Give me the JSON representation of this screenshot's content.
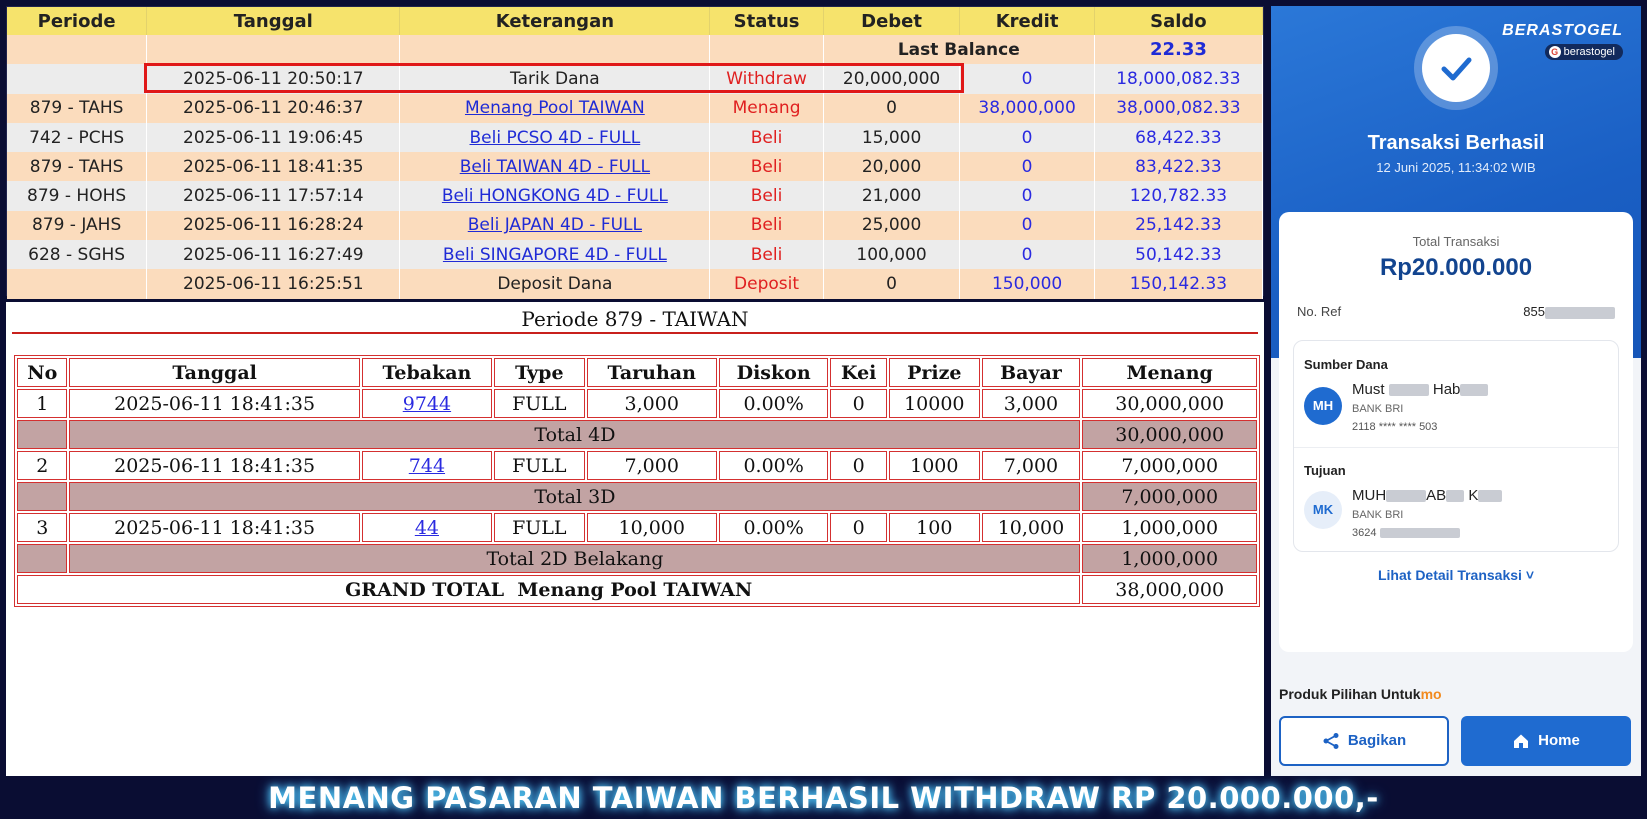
{
  "ledger": {
    "headers": [
      "Periode",
      "Tanggal",
      "Keterangan",
      "Status",
      "Debet",
      "Kredit",
      "Saldo"
    ],
    "last_balance_label": "Last Balance",
    "last_balance_value": "22.33",
    "rows": [
      {
        "periode": "",
        "tanggal": "2025-06-11 20:50:17",
        "ket": "Tarik Dana",
        "status": "Withdraw",
        "debet": "20,000,000",
        "kredit": "0",
        "saldo": "18,000,082.33"
      },
      {
        "periode": "879 - TAHS",
        "tanggal": "2025-06-11 20:46:37",
        "ket": "Menang Pool TAIWAN",
        "status": "Menang",
        "debet": "0",
        "kredit": "38,000,000",
        "saldo": "38,000,082.33"
      },
      {
        "periode": "742 - PCHS",
        "tanggal": "2025-06-11 19:06:45",
        "ket": "Beli PCSO 4D - FULL",
        "status": "Beli",
        "debet": "15,000",
        "kredit": "0",
        "saldo": "68,422.33"
      },
      {
        "periode": "879 - TAHS",
        "tanggal": "2025-06-11 18:41:35",
        "ket": "Beli TAIWAN 4D - FULL",
        "status": "Beli",
        "debet": "20,000",
        "kredit": "0",
        "saldo": "83,422.33"
      },
      {
        "periode": "879 - HOHS",
        "tanggal": "2025-06-11 17:57:14",
        "ket": "Beli HONGKONG 4D - FULL",
        "status": "Beli",
        "debet": "21,000",
        "kredit": "0",
        "saldo": "120,782.33"
      },
      {
        "periode": "879 - JAHS",
        "tanggal": "2025-06-11 16:28:24",
        "ket": "Beli JAPAN 4D - FULL",
        "status": "Beli",
        "debet": "25,000",
        "kredit": "0",
        "saldo": "25,142.33"
      },
      {
        "periode": "628 - SGHS",
        "tanggal": "2025-06-11 16:27:49",
        "ket": "Beli SINGAPORE 4D - FULL",
        "status": "Beli",
        "debet": "100,000",
        "kredit": "0",
        "saldo": "50,142.33"
      },
      {
        "periode": "",
        "tanggal": "2025-06-11 16:25:51",
        "ket": "Deposit Dana",
        "status": "Deposit",
        "debet": "0",
        "kredit": "150,000",
        "saldo": "150,142.33"
      }
    ]
  },
  "detail": {
    "title": "Periode 879 - TAIWAN",
    "headers": [
      "No",
      "Tanggal",
      "Tebakan",
      "Type",
      "Taruhan",
      "Diskon",
      "Kei",
      "Prize",
      "Bayar",
      "Menang"
    ],
    "bets": [
      {
        "no": "1",
        "tanggal": "2025-06-11 18:41:35",
        "tebakan": "9744",
        "type": "FULL",
        "taruhan": "3,000",
        "diskon": "0.00%",
        "kei": "0",
        "prize": "10000",
        "bayar": "3,000",
        "menang": "30,000,000",
        "total_label": "Total 4D",
        "total_value": "30,000,000"
      },
      {
        "no": "2",
        "tanggal": "2025-06-11 18:41:35",
        "tebakan": "744",
        "type": "FULL",
        "taruhan": "7,000",
        "diskon": "0.00%",
        "kei": "0",
        "prize": "1000",
        "bayar": "7,000",
        "menang": "7,000,000",
        "total_label": "Total 3D",
        "total_value": "7,000,000"
      },
      {
        "no": "3",
        "tanggal": "2025-06-11 18:41:35",
        "tebakan": "44",
        "type": "FULL",
        "taruhan": "10,000",
        "diskon": "0.00%",
        "kei": "0",
        "prize": "100",
        "bayar": "10,000",
        "menang": "1,000,000",
        "total_label": "Total 2D Belakang",
        "total_value": "1,000,000"
      }
    ],
    "grand_total_label": "GRAND TOTAL  Menang Pool TAIWAN",
    "grand_total_value": "38,000,000"
  },
  "receipt": {
    "brand": "BERASTOGEL",
    "brand_pill": "berastogel",
    "status_title": "Transaksi Berhasil",
    "datetime": "12 Juni 2025, 11:34:02 WIB",
    "total_label": "Total Transaksi",
    "total_amount": "Rp20.000.000",
    "ref_label": "No. Ref",
    "ref_value_prefix": "855",
    "source_label": "Sumber Dana",
    "source_initials": "MH",
    "source_name_a": "Must",
    "source_name_b": "Hab",
    "source_bank": "BANK BRI",
    "source_account": "2118 **** **** 503",
    "dest_label": "Tujuan",
    "dest_initials": "MK",
    "dest_name_a": "MUH",
    "dest_name_b": "AB",
    "dest_name_c": "K",
    "dest_bank": "BANK BRI",
    "dest_account_prefix": "3624",
    "detail_link": "Lihat Detail Transaksi ˅",
    "produk_label": "Produk Pilihan Untuk",
    "produk_suffix": "mo",
    "share_label": "Bagikan",
    "home_label": "Home",
    "accent_color": "#1f6bd0"
  },
  "caption": "MENANG PASARAN TAIWAN BERHASIL WITHDRAW RP 20.000.000,-"
}
